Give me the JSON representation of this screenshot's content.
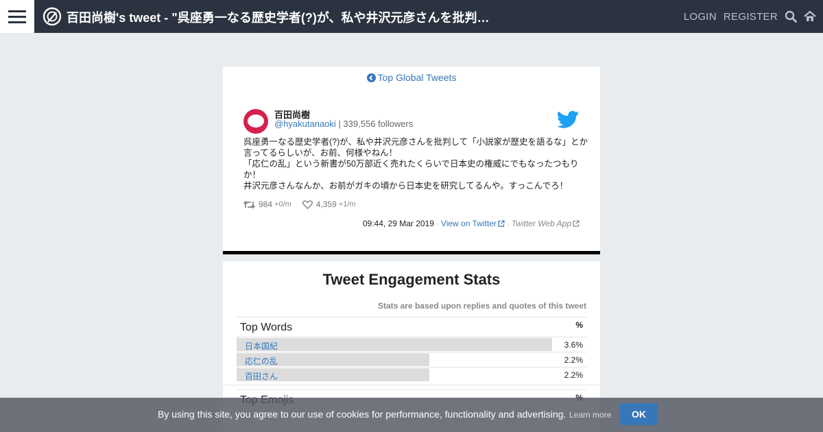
{
  "header": {
    "title": "百田尚樹's tweet - \"呉座勇一なる歴史学者(?)が、私や井沢元彦さんを批判して「小説家が歴史を語るな」とか言ってるらしいが、お前、何様やねん！\"",
    "login_label": "LOGIN",
    "register_label": "REGISTER",
    "icons": [
      "menu-icon",
      "logo-icon",
      "search-icon",
      "home-icon"
    ]
  },
  "back_link": "Top Global Tweets",
  "tweet": {
    "user_name": "百田尚樹",
    "handle": "@hyakutanaoki",
    "followers": "| 339,556 followers",
    "lines": [
      "呉座勇一なる歴史学者(?)が、私や井沢元彦さんを批判して「小説家が歴史を語るな」とか",
      "言ってるらしいが、お前、何様やねん！",
      "「応仁の乱」という新書が50万部近く売れたくらいで日本史の権威にでもなったつもり",
      "か！",
      "井沢元彦さんなんか、お前がガキの頃から日本史を研究してるんや。すっこんでろ！"
    ],
    "retweets": "984",
    "retweet_rate": "+0/m",
    "likes": "4,359",
    "like_rate": "+1/m",
    "timestamp": "09:44, 29 Mar 2019",
    "view_on_twitter": "View on Twitter",
    "source_app": "Twitter Web App"
  },
  "stats": {
    "title": "Tweet Engagement Stats",
    "note": "Stats are based upon replies and quotes of this tweet",
    "top_words_label": "Top Words",
    "top_emojis_label": "Top Emojis",
    "pct_label": "%",
    "words": [
      {
        "word": "日本国紀",
        "value": "3.6%",
        "share": 3.6
      },
      {
        "word": "応仁の乱",
        "value": "2.2%",
        "share": 2.2
      },
      {
        "word": "百田さん",
        "value": "2.2%",
        "share": 2.2
      }
    ]
  },
  "cookie": {
    "text": "By using this site, you agree to our use of cookies for performance, functionality and advertising.",
    "learn_more": "Learn more",
    "ok_label": "OK"
  },
  "colors": {
    "topbar": "#2b3340",
    "link": "#3776b8",
    "avatar": "#d6204e",
    "twitter_blue": "#1da1f2"
  }
}
